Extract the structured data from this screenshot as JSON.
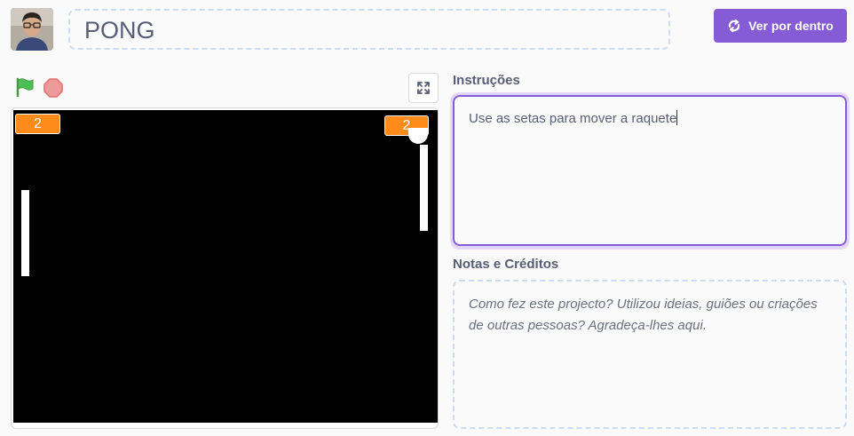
{
  "project": {
    "title": "PONG",
    "see_inside_label": "Ver por dentro"
  },
  "stage": {
    "score_left": "2",
    "score_right": "2"
  },
  "instructions": {
    "label": "Instruções",
    "text": "Use as setas para mover a raquete"
  },
  "notes": {
    "label": "Notas e Créditos",
    "placeholder": "Como fez este projecto? Utilizou ideias, guiões ou criações de outras pessoas? Agradeça-lhes aqui."
  },
  "icons": {
    "avatar": "user-avatar",
    "flag": "green-flag-icon",
    "stop": "stop-icon",
    "fullscreen": "fullscreen-icon",
    "see_inside": "remix-arrows-icon"
  },
  "colors": {
    "accent": "#855cd6",
    "score_bg": "#ff8c1a",
    "flag": "#4cbf56",
    "stop": "#ec5959"
  }
}
